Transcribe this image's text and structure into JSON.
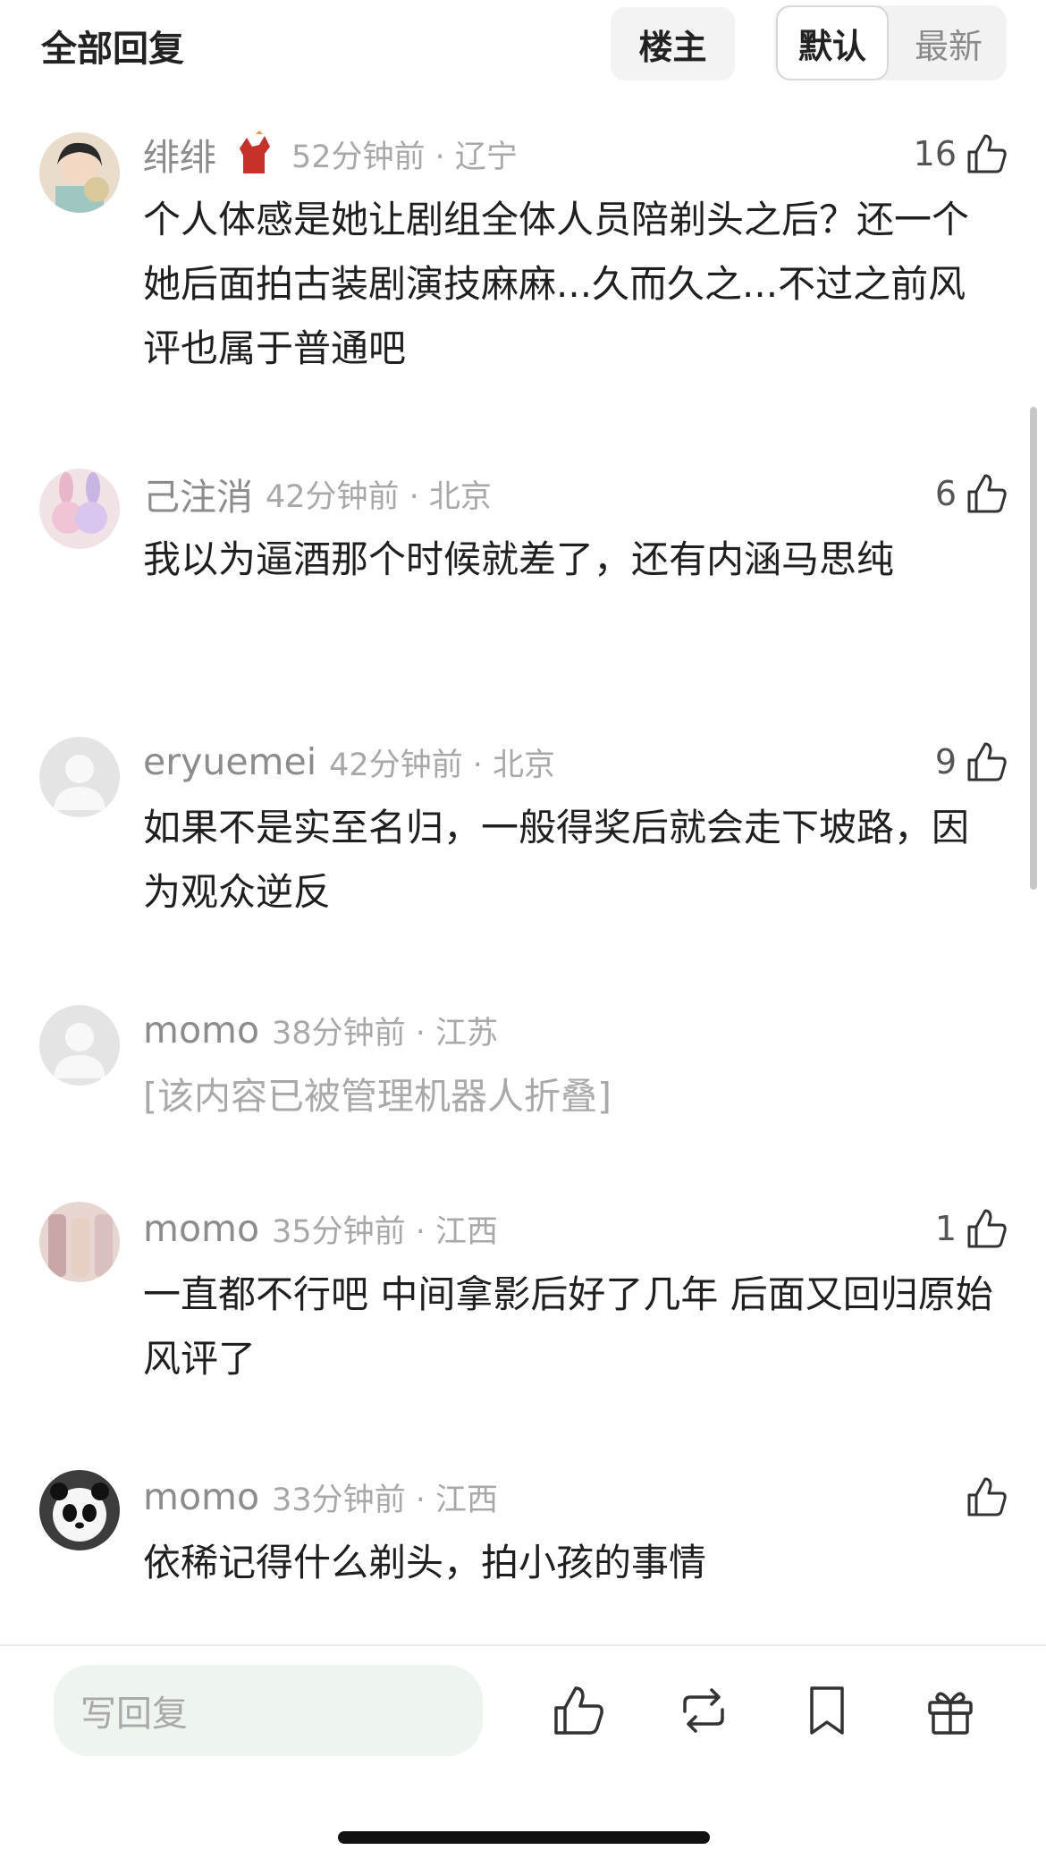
{
  "header": {
    "title": "全部回复",
    "op_filter_label": "楼主",
    "sort_default_label": "默认",
    "sort_latest_label": "最新"
  },
  "comments": [
    {
      "username": "绯绯",
      "time_location": "52分钟前 · 辽宁",
      "likes": "16",
      "text": "个人体感是她让剧组全体人员陪剃头之后？还一个她后面拍古装剧演技麻麻...久而久之...不过之前风评也属于普通吧"
    },
    {
      "username": "己注消",
      "time_location": "42分钟前 · 北京",
      "likes": "6",
      "text": "我以为逼酒那个时候就差了，还有内涵马思纯"
    },
    {
      "username": "eryuemei",
      "time_location": "42分钟前 · 北京",
      "likes": "9",
      "text": "如果不是实至名归，一般得奖后就会走下坡路，因为观众逆反"
    },
    {
      "username": "momo",
      "time_location": "38分钟前 · 江苏",
      "likes": "",
      "text": "[该内容已被管理机器人折叠]"
    },
    {
      "username": "momo",
      "time_location": "35分钟前 · 江西",
      "likes": "1",
      "text": "一直都不行吧 中间拿影后好了几年 后面又回归原始风评了"
    },
    {
      "username": "momo",
      "time_location": "33分钟前 · 江西",
      "likes": "",
      "text": "依稀记得什么剃头，拍小孩的事情"
    }
  ],
  "footer": {
    "reply_placeholder": "写回复",
    "icons": [
      "like-icon",
      "repost-icon",
      "bookmark-icon",
      "gift-icon"
    ]
  },
  "colors": {
    "username": "#8c8c8c",
    "text": "#1f1f1f",
    "folded_text": "#a9a9a9",
    "reply_bg": "#eef5ef"
  }
}
